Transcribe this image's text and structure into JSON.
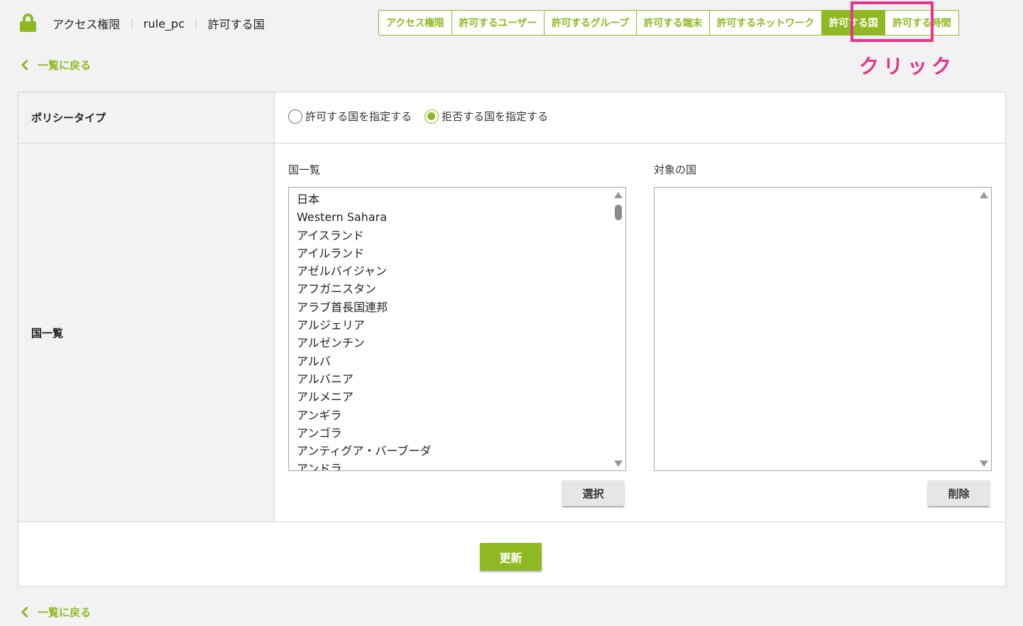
{
  "header": {
    "breadcrumbs": [
      "アクセス権限",
      "rule_pc",
      "許可する国"
    ]
  },
  "tabs": [
    {
      "label": "アクセス権限",
      "active": false
    },
    {
      "label": "許可するユーザー",
      "active": false
    },
    {
      "label": "許可するグループ",
      "active": false
    },
    {
      "label": "許可する端末",
      "active": false
    },
    {
      "label": "許可するネットワーク",
      "active": false
    },
    {
      "label": "許可する国",
      "active": true
    },
    {
      "label": "許可する時間",
      "active": false
    }
  ],
  "annotation": {
    "text": "クリック",
    "color": "#e5348a"
  },
  "back_link": {
    "label": "一覧に戻る"
  },
  "policy": {
    "label": "ポリシータイプ",
    "options": [
      {
        "label": "許可する国を指定する",
        "checked": false
      },
      {
        "label": "拒否する国を指定する",
        "checked": true
      }
    ]
  },
  "countries": {
    "label": "国一覧",
    "list_title": "国一覧",
    "target_title": "対象の国",
    "items": [
      "日本",
      "Western Sahara",
      "アイスランド",
      "アイルランド",
      "アゼルバイジャン",
      "アフガニスタン",
      "アラブ首長国連邦",
      "アルジェリア",
      "アルゼンチン",
      "アルバ",
      "アルバニア",
      "アルメニア",
      "アンギラ",
      "アンゴラ",
      "アンティグア・バーブーダ",
      "アンドラ"
    ],
    "target_items": [],
    "select_label": "選択",
    "delete_label": "削除"
  },
  "update_label": "更新",
  "colors": {
    "accent": "#8fb923",
    "highlight": "#e5348a"
  }
}
